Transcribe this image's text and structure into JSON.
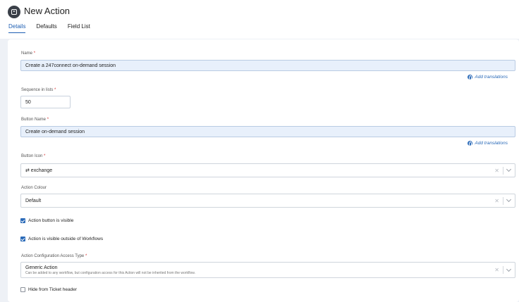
{
  "page": {
    "title": "New Action"
  },
  "tabs": [
    {
      "label": "Details",
      "active": true
    },
    {
      "label": "Defaults",
      "active": false
    },
    {
      "label": "Field List",
      "active": false
    }
  ],
  "form": {
    "name": {
      "label": "Name",
      "value": "Create a 247connect on-demand session"
    },
    "add_translations_label": "Add translations",
    "sequence": {
      "label": "Sequence in lists",
      "value": "50"
    },
    "button_name": {
      "label": "Button Name",
      "value": "Create on-demand session"
    },
    "button_icon": {
      "label": "Button Icon",
      "value": "⇄ exchange",
      "icon": "exchange-icon"
    },
    "action_colour": {
      "label": "Action Colour",
      "value": "Default"
    },
    "action_button_visible": {
      "label": "Action button is visible",
      "checked": true
    },
    "action_visible_outside": {
      "label": "Action is visible outside of Workflows",
      "checked": true
    },
    "access_type": {
      "label": "Action Configuration Access Type",
      "value": "Generic Action",
      "description": "Can be added to any workflow, but configuration access for this Action will not be inherited from the workflow."
    },
    "hide_from_header": {
      "label": "Hide from Ticket header",
      "checked": false
    },
    "required_marker": "*"
  },
  "colors": {
    "accent": "#1e5fb3",
    "required": "#d32f2f",
    "filled_input_bg": "#e8f0fb"
  }
}
